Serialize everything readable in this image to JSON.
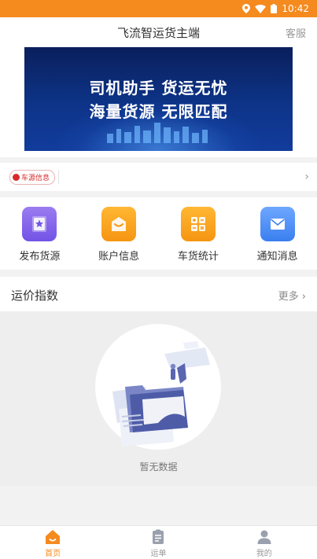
{
  "status_bar": {
    "time": "10:42",
    "icons": [
      "location-icon",
      "wifi-icon",
      "battery-icon"
    ]
  },
  "header": {
    "title": "飞流智运货主端",
    "service": "客服"
  },
  "banner": {
    "line1": "司机助手 货运无忧",
    "line2": "海量货源 无限匹配"
  },
  "notice": {
    "tag": "车源信息",
    "arrow": "›"
  },
  "grid": {
    "items": [
      {
        "label": "发布货源",
        "icon": "star-document-icon"
      },
      {
        "label": "账户信息",
        "icon": "wallet-icon"
      },
      {
        "label": "车货统计",
        "icon": "calculator-icon"
      },
      {
        "label": "通知消息",
        "icon": "envelope-icon"
      }
    ]
  },
  "freight": {
    "title": "运价指数",
    "more": "更多",
    "more_arrow": "›",
    "empty_text": "暂无数据"
  },
  "tabbar": {
    "items": [
      {
        "label": "首页",
        "icon": "home-icon"
      },
      {
        "label": "运单",
        "icon": "clipboard-icon"
      },
      {
        "label": "我的",
        "icon": "user-icon"
      }
    ],
    "active_index": 0
  },
  "colors": {
    "accent": "#f58a1f",
    "purple": "#7253e6",
    "blue": "#3a7ff0"
  }
}
